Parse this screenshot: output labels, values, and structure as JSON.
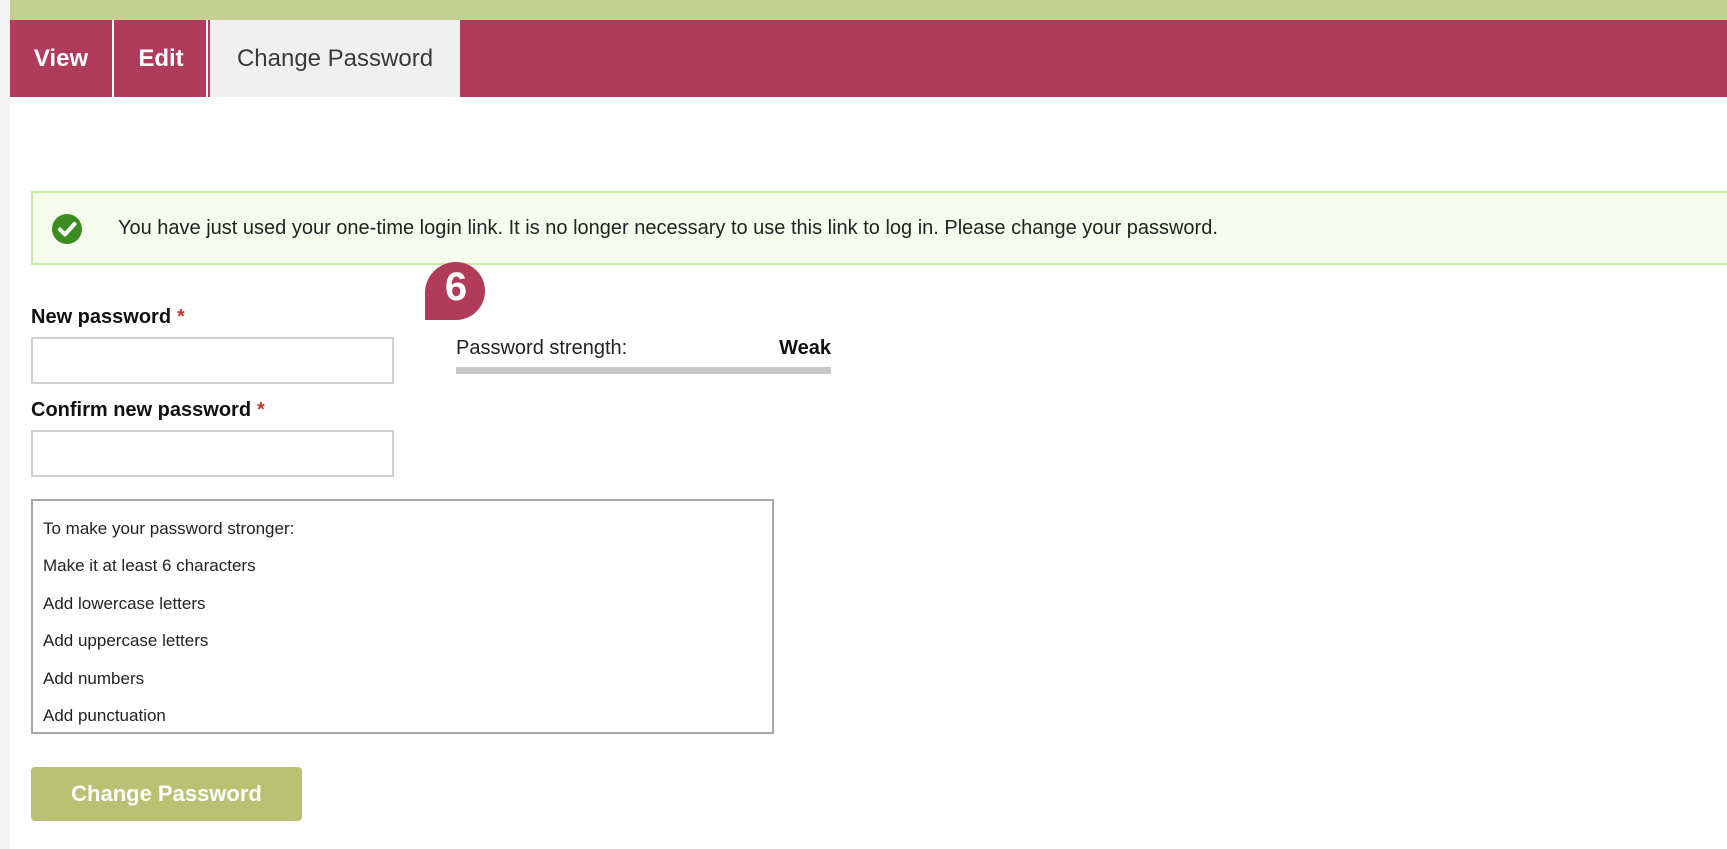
{
  "tabs": {
    "view": "View",
    "edit": "Edit",
    "change_password": "Change Password"
  },
  "status_message": {
    "text": "You have just used your one-time login link. It is no longer necessary to use this link to log in. Please change your password.",
    "icon": "checkmark-circle-icon",
    "color": "#3d8c1f"
  },
  "callout": {
    "number": "6",
    "color": "#b03b5b"
  },
  "form": {
    "new_password_label": "New password",
    "confirm_password_label": "Confirm new password",
    "required_marker": "*",
    "new_password_value": "",
    "confirm_password_value": ""
  },
  "password_strength": {
    "label": "Password strength:",
    "value": "Weak",
    "level_percent": 0
  },
  "suggestions": {
    "heading": "To make your password stronger:",
    "items": [
      "Make it at least 6 characters",
      "Add lowercase letters",
      "Add uppercase letters",
      "Add numbers",
      "Add punctuation"
    ]
  },
  "submit_label": "Change Password",
  "colors": {
    "tab_bar": "#b03b5b",
    "top_band": "#c4d090",
    "button": "#b8c272",
    "alert_border": "#c9e8a4",
    "alert_background": "#f6fcee"
  }
}
